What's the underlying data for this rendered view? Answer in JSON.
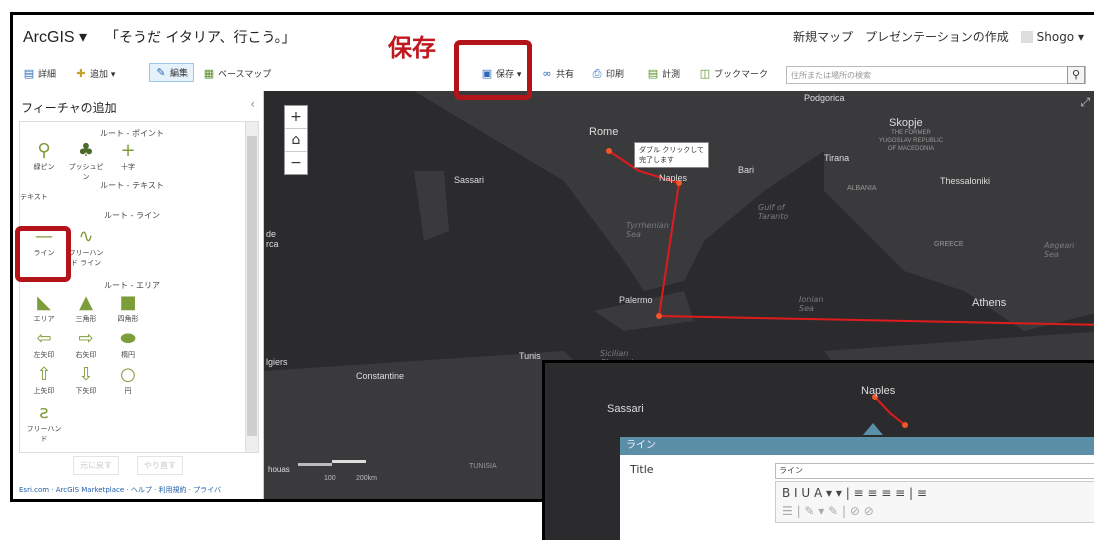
{
  "header": {
    "logo": "ArcGIS ▾",
    "map_title": "「そうだ イタリア、行こう。」",
    "new_map": "新規マップ",
    "create_presentation": "プレゼンテーションの作成",
    "user": "Shogo ▾"
  },
  "toolbar": {
    "details": "詳細",
    "add": "追加 ▾",
    "edit": "編集",
    "basemap": "ベースマップ",
    "save": "保存 ▾",
    "share": "共有",
    "print": "印刷",
    "measure": "計測",
    "bookmark": "ブックマーク",
    "search_placeholder": "住所または場所の検索"
  },
  "annotation": {
    "save_callout": "保存",
    "highlight_color": "#b3141a"
  },
  "sidebar": {
    "title": "フィーチャの追加",
    "sections": {
      "point": "ルート - ポイント",
      "text": "ルート - テキスト",
      "line": "ルート - ライン",
      "area": "ルート - エリア"
    },
    "point_items": [
      "緑ピン",
      "プッシュピン",
      "十字"
    ],
    "text_items": [
      "テキスト"
    ],
    "line_items": [
      "ライン",
      "フリーハンド ライン"
    ],
    "area_items": [
      "エリア",
      "三角形",
      "四角形",
      "左矢印",
      "右矢印",
      "楕円",
      "上矢印",
      "下矢印",
      "円",
      "フリーハンド"
    ],
    "undo": "元に戻す",
    "redo": "やり直す",
    "footer": "Esri.com · ArcGIS Marketplace · ヘルプ · 利用規約 · プライバ"
  },
  "map": {
    "cities": [
      "Podgorica",
      "Skopje",
      "Rome",
      "Tirana",
      "Sassari",
      "Bari",
      "Naples",
      "Thessaloniki",
      "ALBANIA",
      "GREECE",
      "Palermo",
      "Athens",
      "Tunis",
      "Constantine",
      "TUNISIA",
      "lgiers",
      "de",
      "rca"
    ],
    "macedonia": "THE FORMER YUGOSLAV REPUBLIC OF MACEDONIA",
    "seas": [
      "Tyrrhenian Sea",
      "Gulf of Taranto",
      "Ionian Sea",
      "Sicilian Channel",
      "Aegean Sea"
    ],
    "tooltip_line1": "ダブル クリックして",
    "tooltip_line2": "完了します",
    "scale_100": "100",
    "scale_200": "200km",
    "scale_left": "houas"
  },
  "popup": {
    "map_label_sassari": "Sassari",
    "map_label_naples": "Naples",
    "header": "ライン",
    "field_label": "Title",
    "field_value": "ライン",
    "toolbar_row1": "B  I  U  A ▾  ▾ | ≡ ≡ ≡ ≡ | ≡",
    "toolbar_row2": "☰ | ✎ ▾ ✎ | ⊘ ⊘"
  }
}
